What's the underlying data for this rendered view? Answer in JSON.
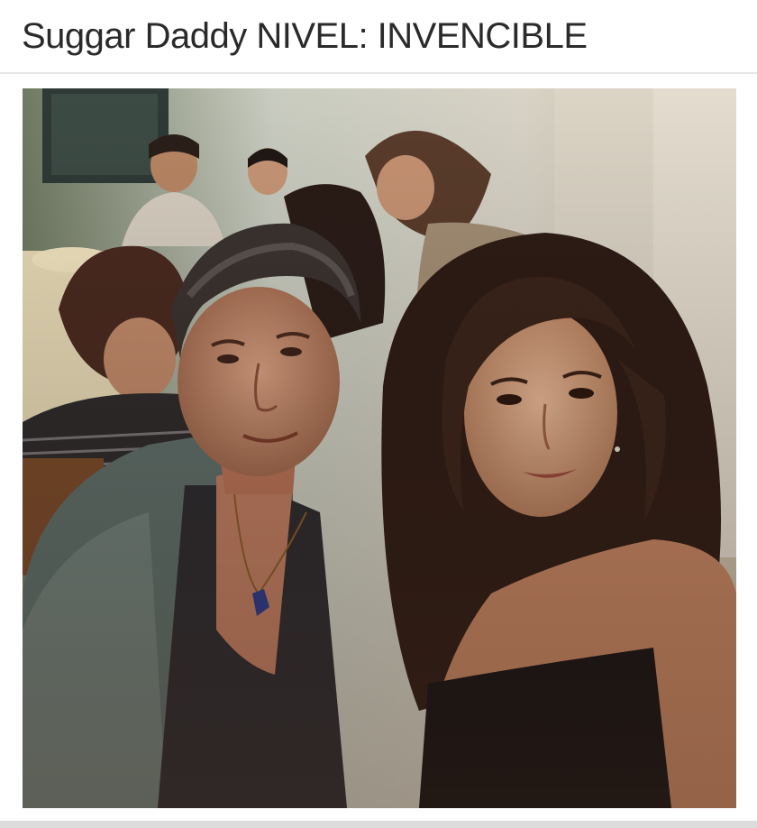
{
  "post": {
    "caption": "Suggar Daddy NIVEL: INVENCIBLE"
  },
  "colors": {
    "caption_text": "#2a2a2a",
    "background": "#ffffff"
  }
}
